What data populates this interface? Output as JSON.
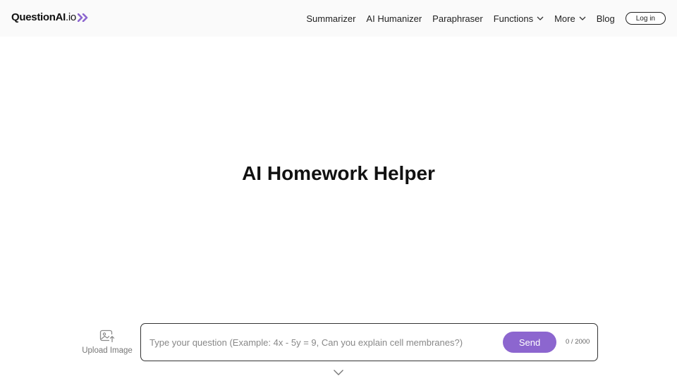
{
  "brand": {
    "name_bold": "QuestionAI",
    "name_suffix": ".io",
    "accent": "#8c66cf"
  },
  "nav": {
    "items": [
      {
        "label": "Summarizer",
        "dropdown": false
      },
      {
        "label": "AI Humanizer",
        "dropdown": false
      },
      {
        "label": "Paraphraser",
        "dropdown": false
      },
      {
        "label": "Functions",
        "dropdown": true
      },
      {
        "label": "More",
        "dropdown": true
      },
      {
        "label": "Blog",
        "dropdown": false
      }
    ],
    "login_label": "Log in"
  },
  "hero": {
    "title": "AI Homework Helper"
  },
  "upload": {
    "label": "Upload Image",
    "icon": "image-upload-icon"
  },
  "question": {
    "placeholder": "Type your question (Example: 4x - 5y = 9, Can you explain cell membranes?)",
    "value": "",
    "send_label": "Send",
    "counter": "0 / 2000"
  },
  "scroll_icon": "chevron-down-icon"
}
